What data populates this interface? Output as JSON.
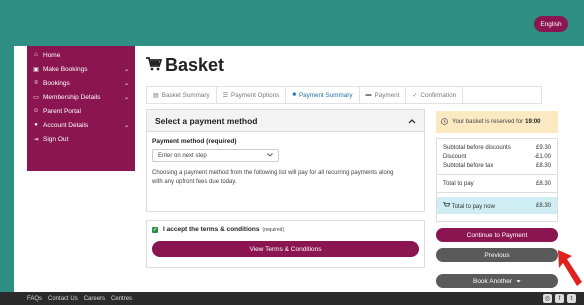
{
  "header": {
    "language_button": "English"
  },
  "sidebar": {
    "items": [
      {
        "label": "Home",
        "icon": "home-icon",
        "glyph": "⌂",
        "chevron": ""
      },
      {
        "label": "Make Bookings",
        "icon": "calendar-icon",
        "glyph": "▣",
        "chevron": "⌄"
      },
      {
        "label": "Bookings",
        "icon": "list-icon",
        "glyph": "≡",
        "chevron": "⌄"
      },
      {
        "label": "Membership Details",
        "icon": "id-card-icon",
        "glyph": "▭",
        "chevron": "⌄"
      },
      {
        "label": "Parent Portal",
        "icon": "person-icon",
        "glyph": "☺",
        "chevron": ""
      },
      {
        "label": "Account Details",
        "icon": "user-icon",
        "glyph": "●",
        "chevron": "⌄"
      },
      {
        "label": "Sign Out",
        "icon": "sign-out-icon",
        "glyph": "⇥",
        "chevron": ""
      }
    ]
  },
  "main": {
    "title": "Basket",
    "steps": [
      {
        "label": "Basket Summary",
        "icon": "cart-icon",
        "glyph": "▤"
      },
      {
        "label": "Payment Options",
        "icon": "list-icon",
        "glyph": "☰"
      },
      {
        "label": "Payment Summary",
        "icon": "document-icon",
        "glyph": "■"
      },
      {
        "label": "Payment",
        "icon": "card-icon",
        "glyph": "▬"
      },
      {
        "label": "Confirmation",
        "icon": "check-icon",
        "glyph": "✓"
      }
    ],
    "active_step": "Payment Summary",
    "payment_panel": {
      "heading": "Select a payment method",
      "method_label": "Payment method (required)",
      "method_value": "Enter on next step",
      "note": "Choosing a payment method from the following list will pay for all recurring payments along with any upfront fees due today."
    },
    "terms": {
      "label": "I accept the terms & conditions",
      "required_tag": "(required)",
      "view_button": "View Terms & Conditions"
    }
  },
  "basket_summary": {
    "reserved_text": "Your basket is reserved for",
    "reserved_time": "19:00",
    "rows": [
      {
        "label": "Subtotal before discounts",
        "value": "£9.30"
      },
      {
        "label": "Discount",
        "value": "-£1.00"
      },
      {
        "label": "Subtotal before tax",
        "value": "£8.30"
      }
    ],
    "total_label": "Total to pay",
    "total_value": "£8.30",
    "pay_now_label": "Total to pay now",
    "pay_now_value": "£8.30"
  },
  "actions": {
    "continue": "Continue to Payment",
    "previous": "Previous",
    "book_another": "Book Another"
  },
  "footer": {
    "links": [
      "FAQs",
      "Contact Us",
      "Careers",
      "Centres"
    ]
  },
  "colors": {
    "brand": "#8a1550",
    "background": "#2f8f84",
    "secondary_button": "#5a5a5a",
    "reserved_banner": "#fbe9c2",
    "pay_now_banner": "#cfeef4",
    "pointer": "#e0201f"
  }
}
